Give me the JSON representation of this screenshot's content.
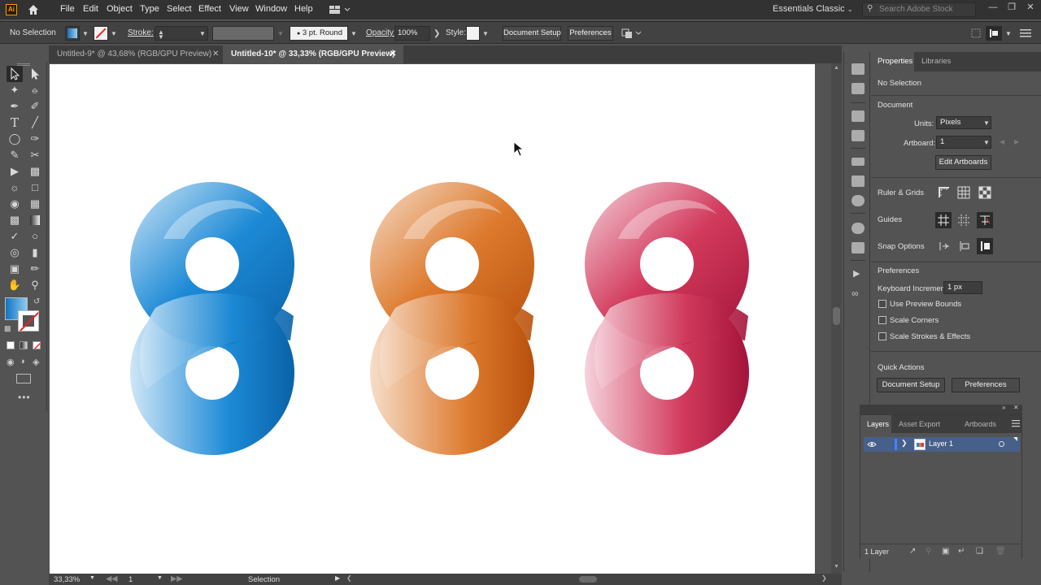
{
  "menubar": {
    "app_logo": "Ai",
    "items": [
      "File",
      "Edit",
      "Object",
      "Type",
      "Select",
      "Effect",
      "View",
      "Window",
      "Help"
    ],
    "workspace": "Essentials Classic",
    "search_placeholder": "Search Adobe Stock"
  },
  "controlbar": {
    "selection": "No Selection",
    "stroke_label": "Stroke:",
    "brush": "3 pt. Round",
    "opacity_label": "Opacity:",
    "opacity_value": "100%",
    "style_label": "Style:",
    "document_setup": "Document Setup",
    "preferences": "Preferences"
  },
  "tabs": [
    {
      "label": "Untitled-9* @ 43,68% (RGB/GPU Preview)",
      "active": false
    },
    {
      "label": "Untitled-10* @ 33,33% (RGB/GPU Preview)",
      "active": true
    }
  ],
  "artwork": {
    "shapes": [
      {
        "name": "blue",
        "dark": "#0a62a8",
        "mid": "#1d8ad6",
        "light": "#cfe6f6"
      },
      {
        "name": "orange",
        "dark": "#b8500c",
        "mid": "#dd7a2e",
        "light": "#f6ddc9"
      },
      {
        "name": "crimson",
        "dark": "#a3143a",
        "mid": "#d23a5c",
        "light": "#f5d2dc"
      }
    ]
  },
  "statusbar": {
    "zoom": "33,33%",
    "artboard": "1",
    "tool": "Selection"
  },
  "properties": {
    "tabs": [
      "Properties",
      "Libraries"
    ],
    "selection": "No Selection",
    "document_heading": "Document",
    "units_label": "Units:",
    "units_value": "Pixels",
    "artboard_label": "Artboard:",
    "artboard_value": "1",
    "edit_artboards": "Edit Artboards",
    "ruler_grids": "Ruler & Grids",
    "guides": "Guides",
    "snap_options": "Snap Options",
    "preferences_heading": "Preferences",
    "keyboard_increment_label": "Keyboard Increment:",
    "keyboard_increment_value": "1 px",
    "use_preview_bounds": "Use Preview Bounds",
    "scale_corners": "Scale Corners",
    "scale_strokes": "Scale Strokes & Effects",
    "quick_actions": "Quick Actions",
    "qa_document_setup": "Document Setup",
    "qa_preferences": "Preferences"
  },
  "layers": {
    "tabs": [
      "Layers",
      "Asset Export",
      "Artboards"
    ],
    "layer_name": "Layer 1",
    "count": "1 Layer"
  }
}
